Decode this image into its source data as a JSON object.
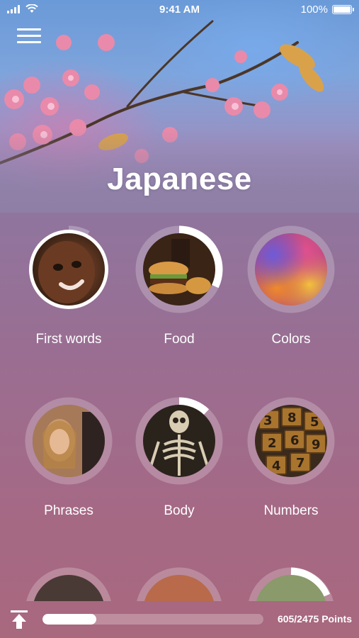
{
  "status_bar": {
    "time": "9:41 AM",
    "battery": "100%"
  },
  "header": {
    "title": "Japanese"
  },
  "categories": [
    {
      "label": "First words",
      "progress": 0.08,
      "photo": "child-face"
    },
    {
      "label": "Food",
      "progress": 0.32,
      "photo": "burger"
    },
    {
      "label": "Colors",
      "progress": 0,
      "photo": "color-powder"
    },
    {
      "label": "Phrases",
      "progress": 0,
      "photo": "people-talking"
    },
    {
      "label": "Body",
      "progress": 0.12,
      "photo": "skeleton"
    },
    {
      "label": "Numbers",
      "progress": 0,
      "photo": "type-blocks"
    }
  ],
  "footer": {
    "points": "605/2475 Points",
    "progress": 0.244
  },
  "colors": {
    "ring_track": "rgba(255,255,255,0.22)",
    "ring_fill": "#ffffff",
    "accent": "#ffffff"
  }
}
